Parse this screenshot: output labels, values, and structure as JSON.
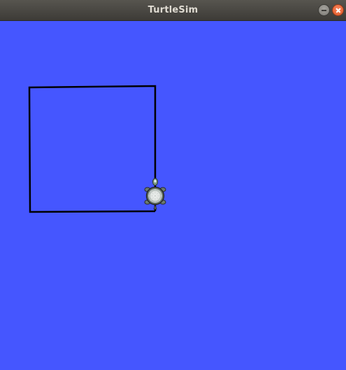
{
  "window": {
    "title": "TurtleSim",
    "minimize_icon": "minimize-icon",
    "close_icon": "close-icon"
  },
  "canvas": {
    "background_color": "#4556ff",
    "pen_color": "#000000",
    "turtle_icon": "turtle-icon"
  }
}
